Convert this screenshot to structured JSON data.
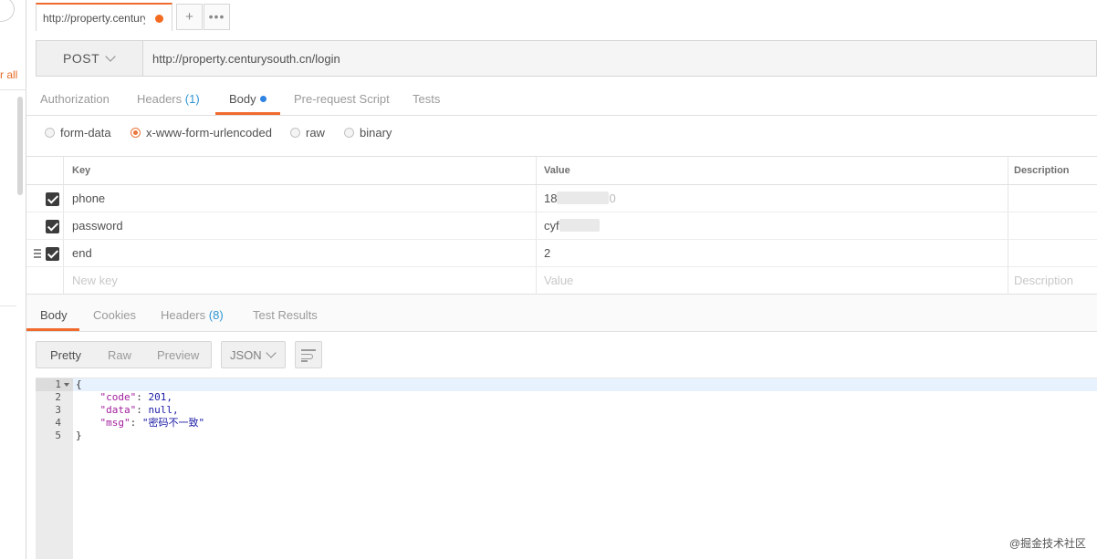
{
  "sidebar": {
    "link_partial": "r all"
  },
  "tab": {
    "title": "http://property.centurysouth.cn/login",
    "plus": "+",
    "more": "•••"
  },
  "request": {
    "method": "POST",
    "url": "http://property.centurysouth.cn/login"
  },
  "request_tabs": {
    "authorization": "Authorization",
    "headers": "Headers",
    "headers_count": "(1)",
    "body": "Body",
    "prerequest": "Pre-request Script",
    "tests": "Tests"
  },
  "body_types": {
    "form_data": "form-data",
    "urlencoded": "x-www-form-urlencoded",
    "raw": "raw",
    "binary": "binary",
    "selected": "x-www-form-urlencoded"
  },
  "params": {
    "headers": {
      "key": "Key",
      "value": "Value",
      "description": "Description"
    },
    "rows": [
      {
        "key": "phone",
        "value_visible": "18",
        "value_tail": "0"
      },
      {
        "key": "password",
        "value_visible": "cyf",
        "value_tail": ""
      },
      {
        "key": "end",
        "value_visible": "2",
        "value_tail": ""
      }
    ],
    "new_row": {
      "key_placeholder": "New key",
      "value_placeholder": "Value",
      "description_placeholder": "Description"
    }
  },
  "response_tabs": {
    "body": "Body",
    "cookies": "Cookies",
    "headers": "Headers",
    "headers_count": "(8)",
    "test_results": "Test Results"
  },
  "response_toolbar": {
    "pretty": "Pretty",
    "raw": "Raw",
    "preview": "Preview",
    "format": "JSON"
  },
  "response_body": {
    "line_numbers": [
      "1",
      "2",
      "3",
      "4",
      "5"
    ],
    "open_brace": "{",
    "close_brace": "}",
    "fields": [
      {
        "key": "\"code\"",
        "value": "201,"
      },
      {
        "key": "\"data\"",
        "value": "null,"
      },
      {
        "key": "\"msg\"",
        "value": "\"密码不一致\""
      }
    ]
  },
  "watermark": "@掘金技术社区",
  "colors": {
    "accent": "#f06a2d",
    "count": "#2e95d3",
    "body_dot": "#2f83e2"
  }
}
